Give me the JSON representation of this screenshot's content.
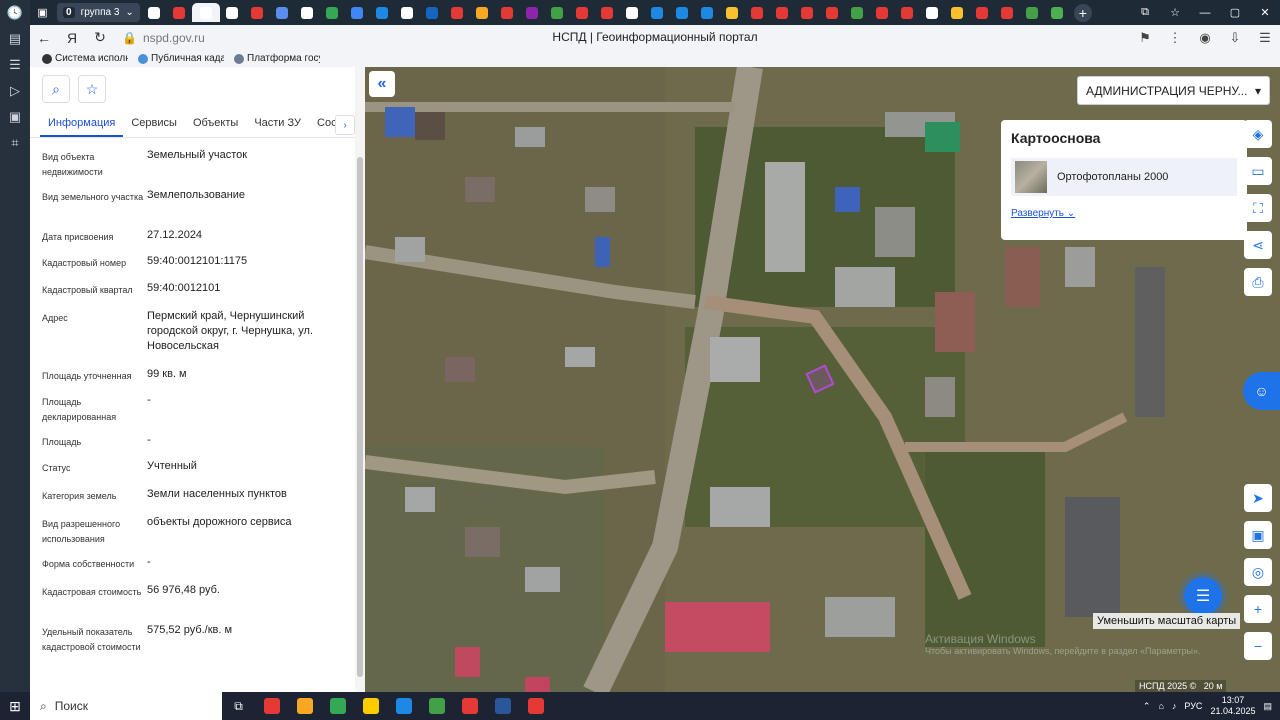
{
  "browser": {
    "tab_group": {
      "count": "0",
      "label": "группа 3"
    },
    "tab_favicons": [
      "#ffffff",
      "#e53935",
      "#ffffff",
      "#ffffff",
      "#e53935",
      "#5b8def",
      "#ffffff",
      "#34a853",
      "#4285f4",
      "#1e88e5",
      "#ffffff",
      "#1565c0",
      "#e53935",
      "#f9a825",
      "#e53935",
      "#8e24aa",
      "#43a047",
      "#e53935",
      "#e53935",
      "#ffffff",
      "#1e88e5",
      "#1e88e5",
      "#1e88e5",
      "#fbc02d",
      "#e53935",
      "#e53935",
      "#e53935",
      "#e53935",
      "#43a047",
      "#e53935",
      "#e53935",
      "#ffffff",
      "#fbc02d",
      "#e53935",
      "#e53935",
      "#43a047",
      "#4caf50"
    ],
    "url": "nspd.gov.ru",
    "page_title": "НСПД | Геоинформационный портал",
    "bookmarks": [
      {
        "label": "Система исполне...",
        "color": "#333333"
      },
      {
        "label": "Публичная кадас...",
        "color": "#4a90d9"
      },
      {
        "label": "Платформа госуд...",
        "color": "#6b7c93"
      }
    ]
  },
  "panel": {
    "tabs": [
      "Информация",
      "Сервисы",
      "Объекты",
      "Части ЗУ",
      "Состав"
    ],
    "active_tab": "Информация",
    "rows": [
      {
        "label": "Вид объекта недвижимости",
        "value": "Земельный участок"
      },
      {
        "label": "Вид земельного участка",
        "value": "Землепользование"
      },
      {
        "label": "Дата присвоения",
        "value": "27.12.2024"
      },
      {
        "label": "Кадастровый номер",
        "value": "59:40:0012101:1175"
      },
      {
        "label": "Кадастровый квартал",
        "value": "59:40:0012101"
      },
      {
        "label": "Адрес",
        "value": "Пермский край, Чернушинский городской округ, г. Чернушка, ул. Новосельская"
      },
      {
        "label": "Площадь уточненная",
        "value": "99 кв. м"
      },
      {
        "label": "Площадь декларированная",
        "value": "-"
      },
      {
        "label": "Площадь",
        "value": "-"
      },
      {
        "label": "Статус",
        "value": "Учтенный"
      },
      {
        "label": "Категория земель",
        "value": "Земли населенных пунктов"
      },
      {
        "label": "Вид разрешенного использования",
        "value": "объекты дорожного сервиса"
      },
      {
        "label": "Форма собственности",
        "value": "-"
      },
      {
        "label": "Кадастровая стоимость",
        "value": "56 976,48 руб."
      },
      {
        "label": "Удельный показатель кадастровой стоимости",
        "value": "575,52 руб./кв. м"
      }
    ]
  },
  "map": {
    "region_select": "АДМИНИСТРАЦИЯ ЧЕРНУ...",
    "basemap_title": "Картооснова",
    "basemap_item": "Ортофотопланы 2000",
    "basemap_expand": "Развернуть",
    "zoom_out_tooltip": "Уменьшить масштаб карты",
    "watermark_title": "Активация Windows",
    "watermark_sub": "Чтобы активировать Windows, перейдите в раздел «Параметры».",
    "copyright": "НСПД 2025 ©",
    "scale_label": "20 м"
  },
  "taskbar": {
    "search_label": "Поиск",
    "lang": "РУС",
    "time": "13:07",
    "date": "21.04.2025",
    "app_colors": [
      "#e53935",
      "#f9a825",
      "#34a853",
      "#ffcc00",
      "#1e88e5",
      "#43a047",
      "#e53935",
      "#2b579a",
      "#e53935"
    ]
  }
}
